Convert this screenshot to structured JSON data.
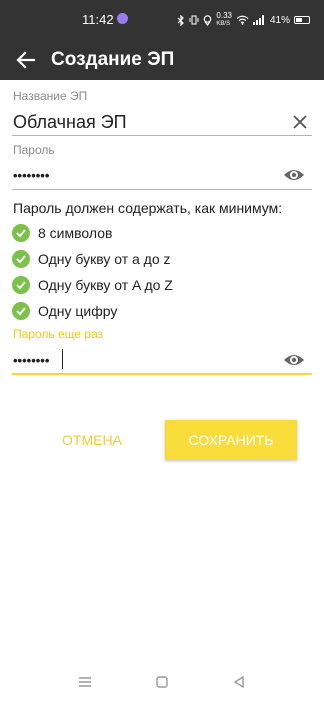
{
  "status_bar": {
    "time": "11:42",
    "speed_value": "0.33",
    "speed_unit": "KB/S",
    "battery": "41%",
    "icons": [
      "app-notification-icon",
      "bluetooth-icon",
      "vibrate-icon",
      "location-icon",
      "wifi-icon",
      "signal-icon",
      "battery-icon"
    ]
  },
  "app_bar": {
    "title": "Создание ЭП"
  },
  "form": {
    "name_label": "Название ЭП",
    "name_value": "Облачная ЭП",
    "password_label": "Пароль",
    "password_value": "••••••••",
    "rules_title": "Пароль должен содержать, как минимум:",
    "rules": [
      {
        "label": "8 символов"
      },
      {
        "label": "Одну букву от a до z"
      },
      {
        "label": "Одну букву от A до Z"
      },
      {
        "label": "Одну цифру"
      }
    ],
    "repeat_label": "Пароль еще раз",
    "repeat_value": "••••••••"
  },
  "buttons": {
    "cancel": "ОТМЕНА",
    "save": "СОХРАНИТЬ"
  },
  "colors": {
    "app_bar": "#333333",
    "accent": "#f8dd3a",
    "check": "#7cc24a"
  }
}
